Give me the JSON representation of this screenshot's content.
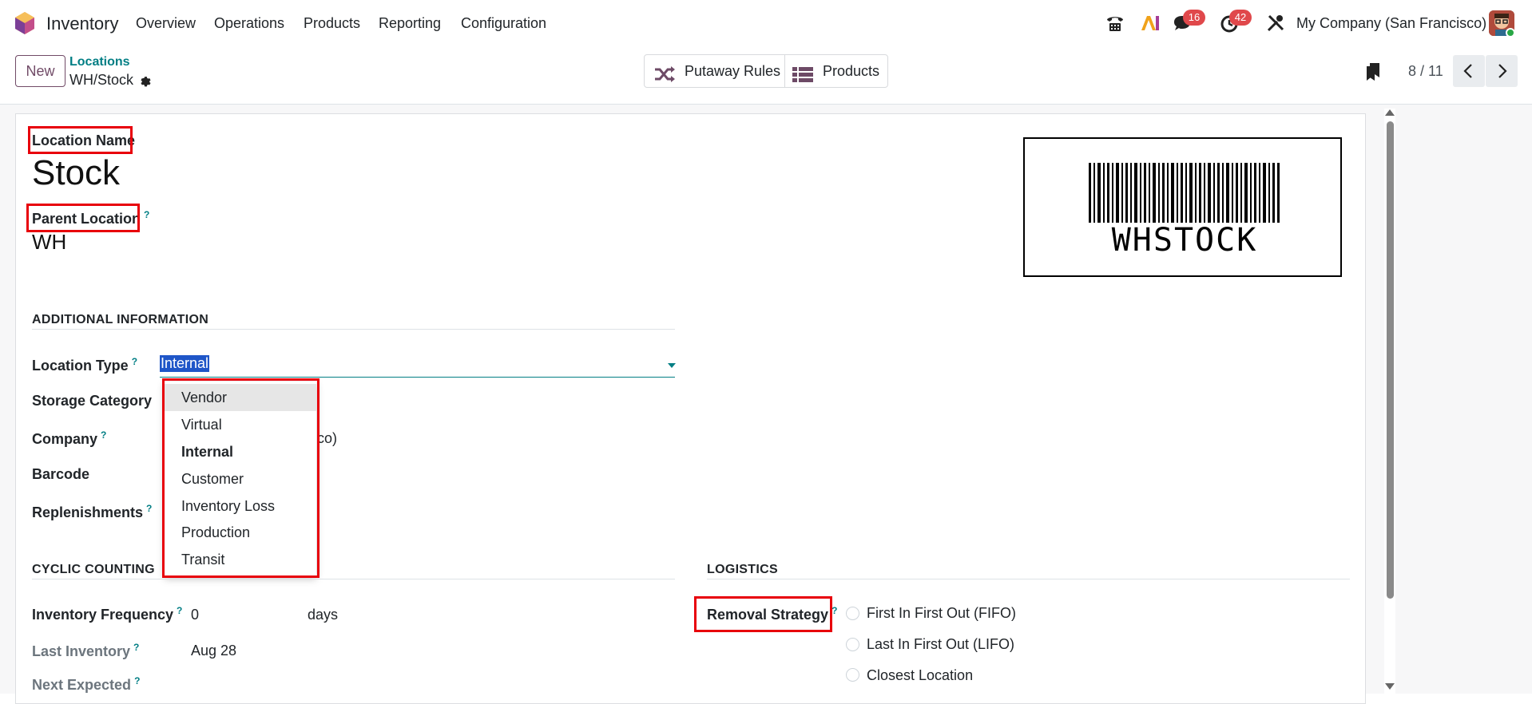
{
  "topbar": {
    "app_name": "Inventory",
    "nav": [
      "Overview",
      "Operations",
      "Products",
      "Reporting",
      "Configuration"
    ],
    "messages_badge": "16",
    "activities_badge": "42",
    "company": "My Company (San Francisco)"
  },
  "control_panel": {
    "new_label": "New",
    "breadcrumb_parent": "Locations",
    "breadcrumb_current": "WH/Stock",
    "smart_buttons": [
      "Putaway Rules",
      "Products"
    ],
    "pager": "8 / 11"
  },
  "form": {
    "location_name_label": "Location Name",
    "location_name": "Stock",
    "parent_location_label": "Parent Location",
    "parent_location": "WH",
    "barcode_text": "WHSTOCK",
    "additional_info_title": "ADDITIONAL INFORMATION",
    "location_type_label": "Location Type",
    "location_type_value": "Internal",
    "storage_category_label": "Storage Category",
    "company_label": "Company",
    "company_value_partial": "co)",
    "barcode_label": "Barcode",
    "replenishments_label": "Replenishments",
    "location_type_options": [
      "Vendor",
      "Virtual",
      "Internal",
      "Customer",
      "Inventory Loss",
      "Production",
      "Transit"
    ],
    "cyclic_counting_title": "CYCLIC COUNTING",
    "inventory_frequency_label": "Inventory Frequency",
    "inventory_frequency_value": "0",
    "inventory_frequency_unit": "days",
    "last_inventory_label": "Last Inventory",
    "last_inventory_value": "Aug 28",
    "next_expected_label": "Next Expected",
    "logistics_title": "LOGISTICS",
    "removal_strategy_label": "Removal Strategy",
    "removal_options": [
      "First In First Out (FIFO)",
      "Last In First Out (LIFO)",
      "Closest Location"
    ]
  },
  "colors": {
    "brand": "#714b67",
    "accent": "#017e84",
    "highlight": "#e8000b",
    "badge": "#e0484b"
  }
}
